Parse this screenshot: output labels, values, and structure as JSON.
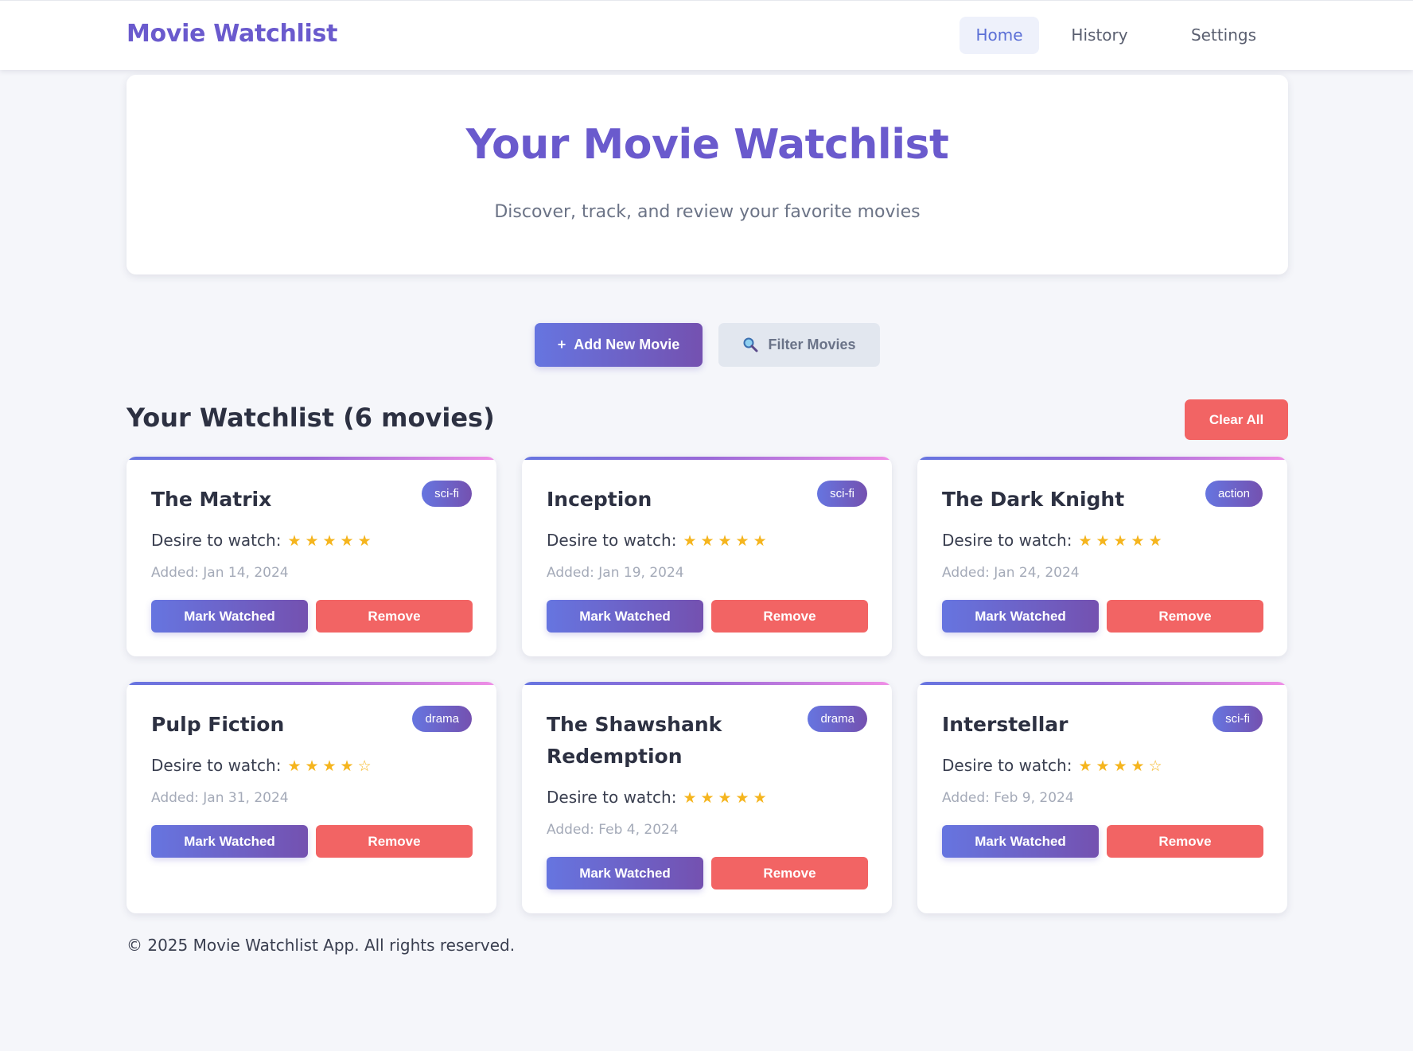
{
  "header": {
    "brand": "Movie Watchlist",
    "nav": [
      {
        "label": "Home",
        "active": true
      },
      {
        "label": "History",
        "active": false
      },
      {
        "label": "Settings",
        "active": false
      }
    ]
  },
  "hero": {
    "title": "Your Movie Watchlist",
    "subtitle": "Discover, track, and review your favorite movies"
  },
  "actions": {
    "add_icon": "+",
    "add_label": "Add New Movie",
    "filter_icon": "search-icon",
    "filter_label": "Filter Movies"
  },
  "watchlist": {
    "title": "Your Watchlist (6 movies)",
    "clear_label": "Clear All",
    "desire_label": "Desire to watch:",
    "mark_label": "Mark Watched",
    "remove_label": "Remove",
    "movies": [
      {
        "title": "The Matrix",
        "genre": "sci-fi",
        "rating": 5,
        "stars": "★★★★★",
        "added": "Added: Jan 14, 2024"
      },
      {
        "title": "Inception",
        "genre": "sci-fi",
        "rating": 5,
        "stars": "★★★★★",
        "added": "Added: Jan 19, 2024"
      },
      {
        "title": "The Dark Knight",
        "genre": "action",
        "rating": 5,
        "stars": "★★★★★",
        "added": "Added: Jan 24, 2024"
      },
      {
        "title": "Pulp Fiction",
        "genre": "drama",
        "rating": 4,
        "stars": "★★★★☆",
        "added": "Added: Jan 31, 2024"
      },
      {
        "title": "The Shawshank Redemption",
        "genre": "drama",
        "rating": 5,
        "stars": "★★★★★",
        "added": "Added: Feb 4, 2024"
      },
      {
        "title": "Interstellar",
        "genre": "sci-fi",
        "rating": 4,
        "stars": "★★★★☆",
        "added": "Added: Feb 9, 2024"
      }
    ]
  },
  "footer": {
    "text": "© 2025 Movie Watchlist App. All rights reserved."
  },
  "colors": {
    "brand": "#6a5acd",
    "primary_start": "#6675e0",
    "primary_end": "#7451b0",
    "danger": "#f26464",
    "star": "#f5b51e"
  }
}
